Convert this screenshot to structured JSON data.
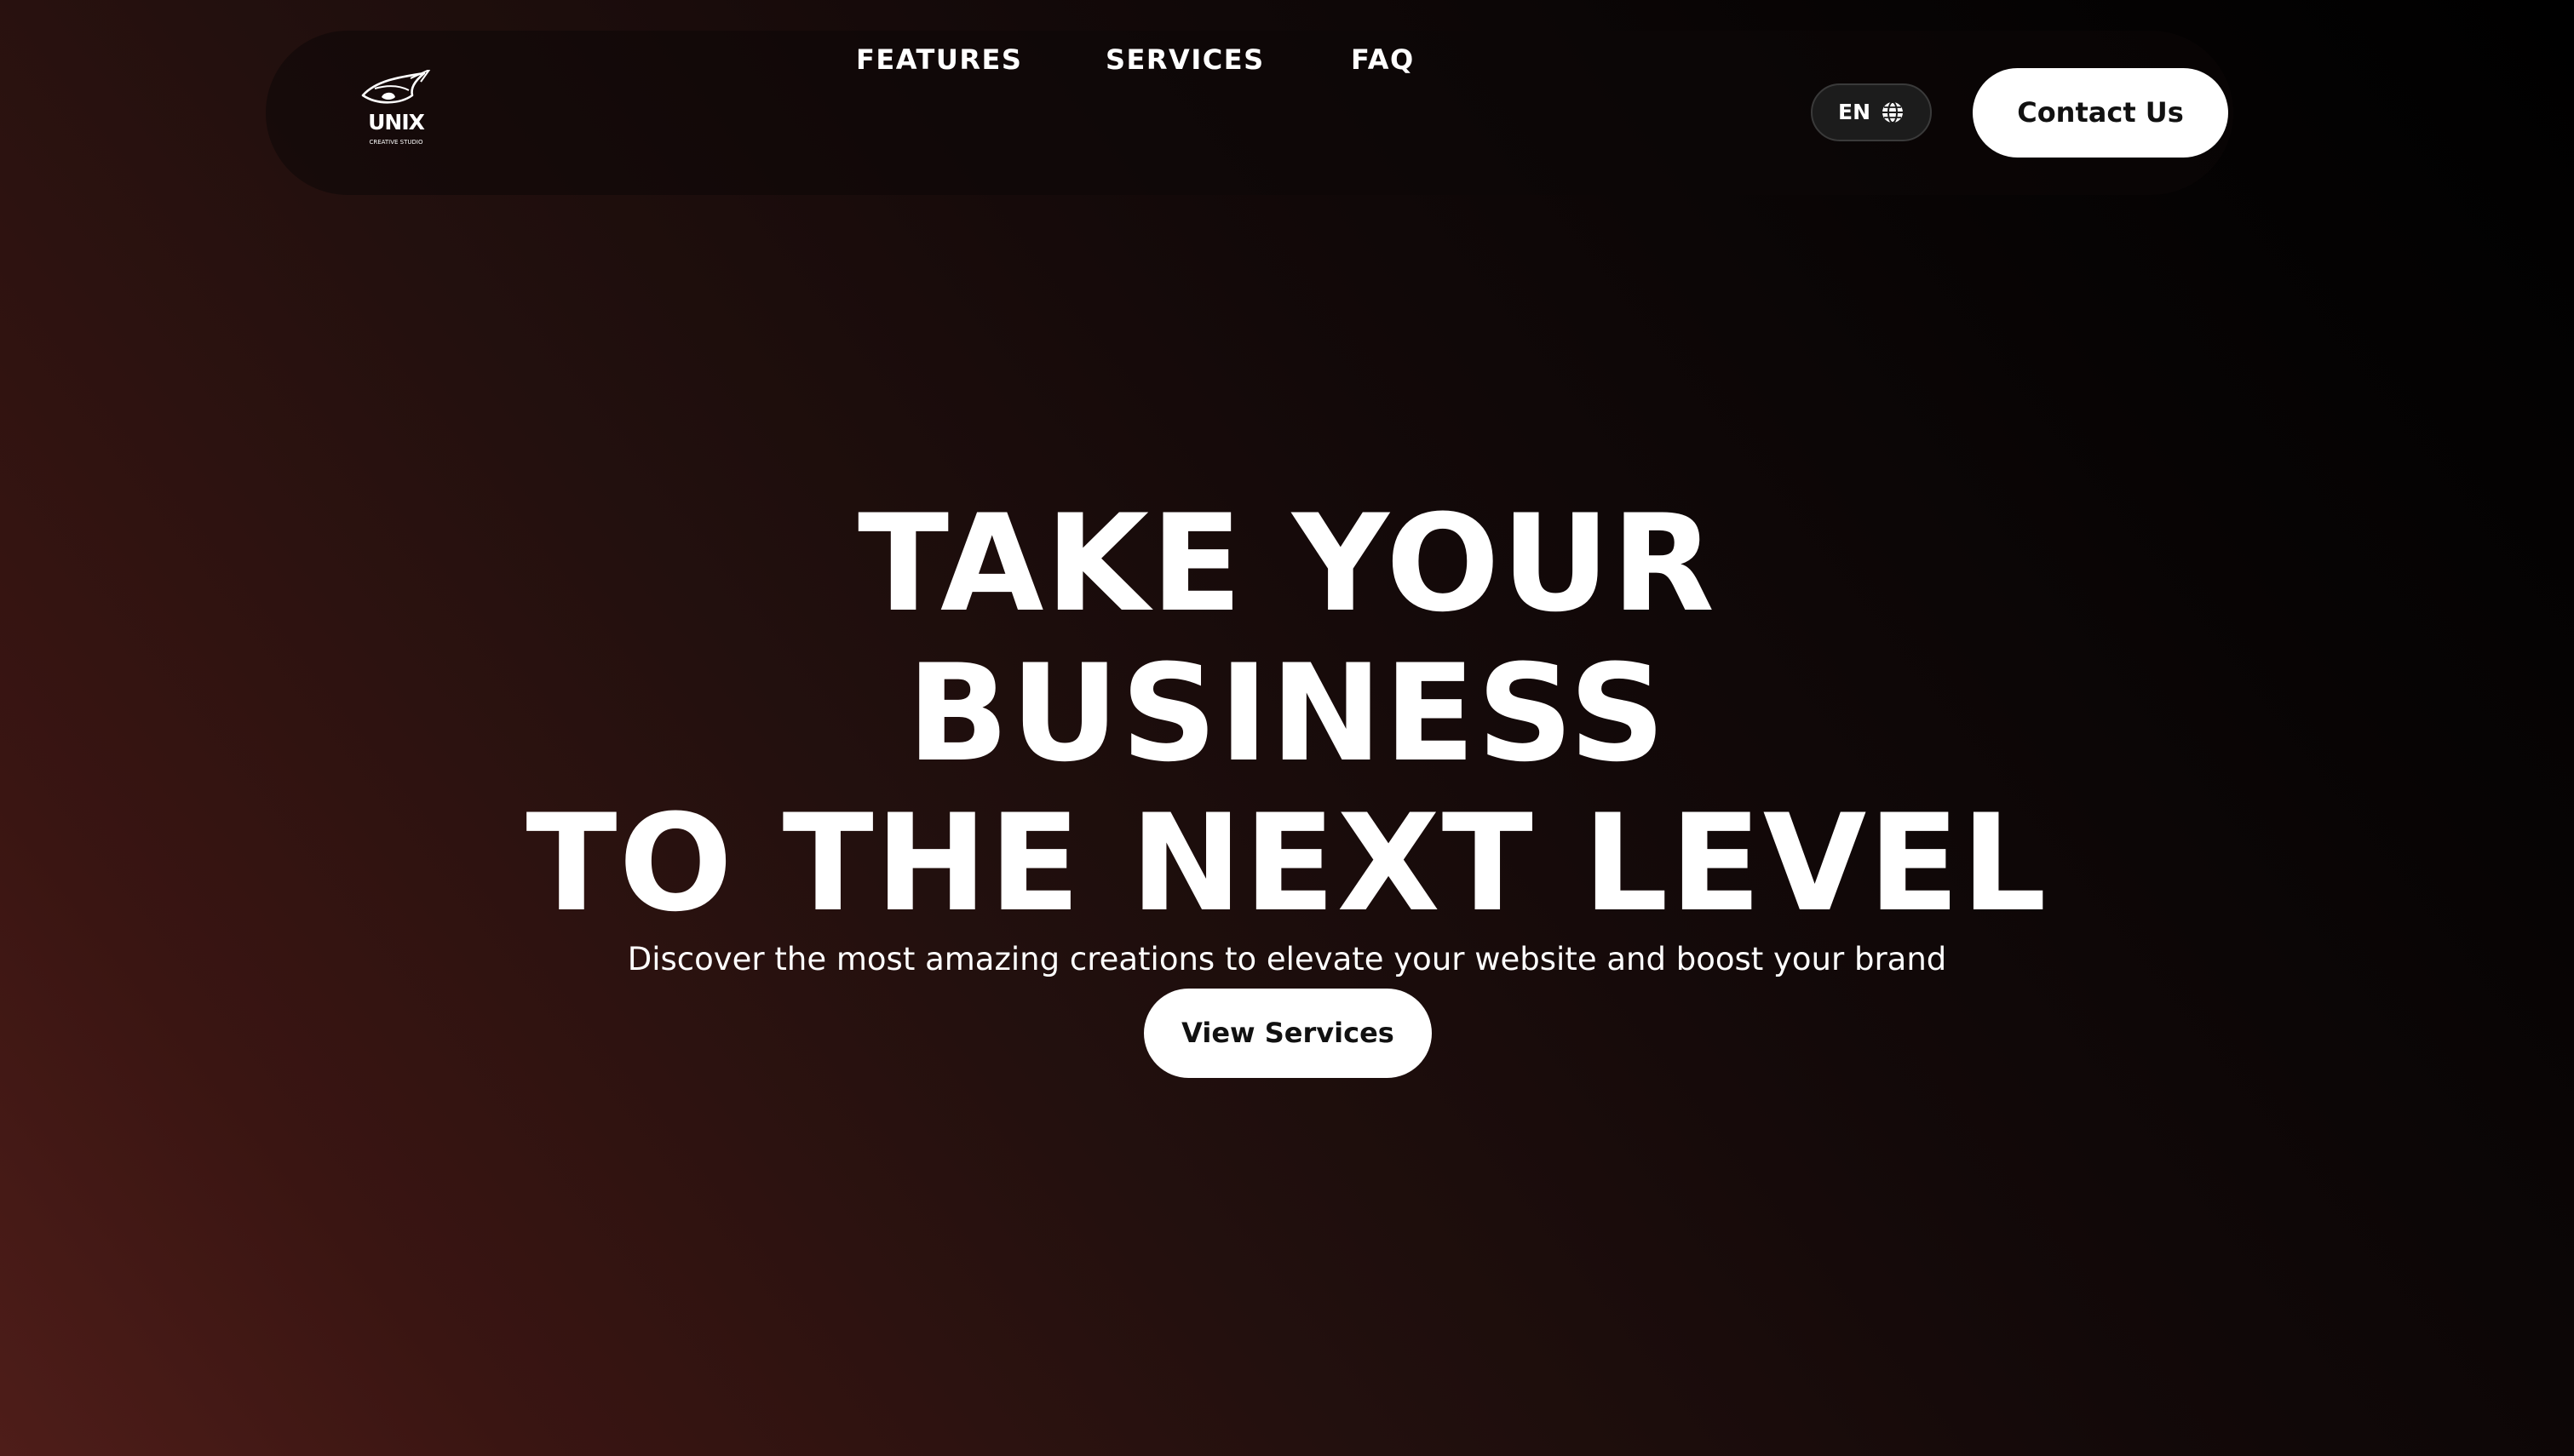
{
  "header": {
    "logo": {
      "word": "UNIX",
      "sub": "CREATIVE STUDIO"
    },
    "nav": [
      {
        "label": "FEATURES"
      },
      {
        "label": "SERVICES"
      },
      {
        "label": "FAQ"
      }
    ],
    "language": {
      "label": "EN",
      "icon": "globe-icon"
    },
    "contact_label": "Contact Us"
  },
  "hero": {
    "title_lines": [
      "TAKE YOUR",
      "BUSINESS",
      "TO THE NEXT LEVEL"
    ],
    "subtitle": "Discover the most amazing creations to elevate your website and boost your brand",
    "cta_label": "View Services"
  },
  "colors": {
    "background_warm": "#4e1d19",
    "background_dark": "#000000",
    "button_bg": "#ffffff",
    "button_text": "#111111",
    "text": "#ffffff"
  }
}
